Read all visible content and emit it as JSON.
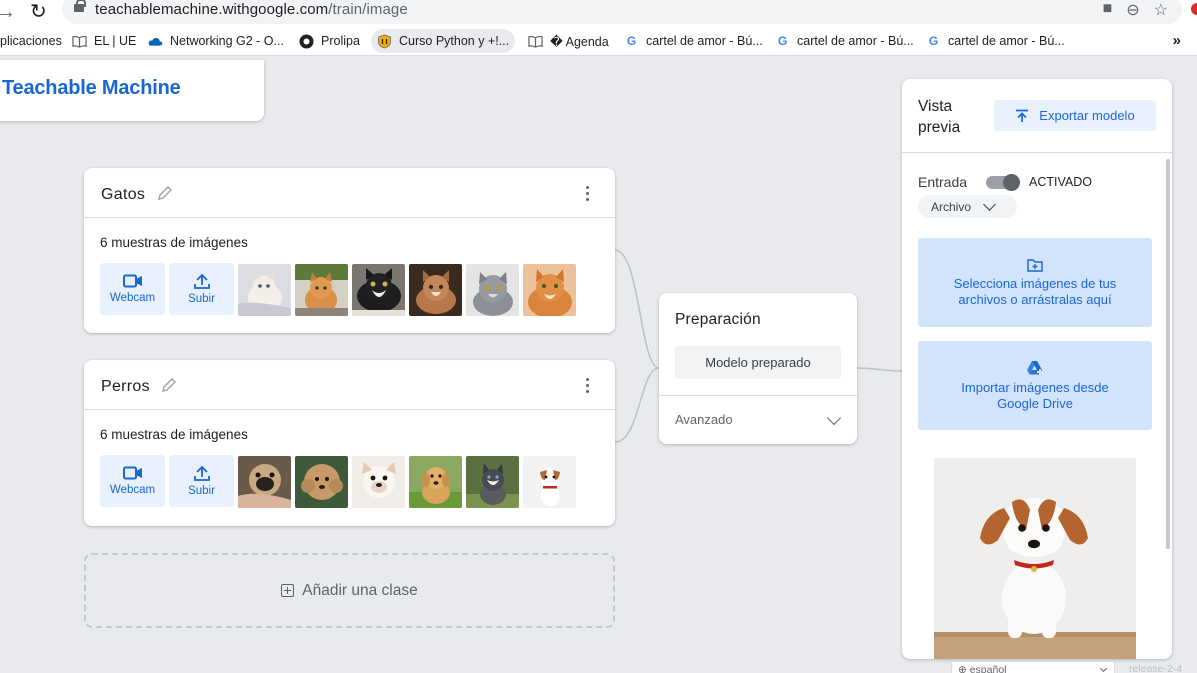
{
  "browser": {
    "url_host": "teachablemachine.withgoogle.com",
    "url_path": "/train/image",
    "bookmarks": [
      {
        "label": "plicaciones",
        "icon": "apps-icon"
      },
      {
        "label": "EL | UE",
        "icon": "book-icon"
      },
      {
        "label": "Networking G2 - O...",
        "icon": "cloud-icon"
      },
      {
        "label": "Prolipa",
        "icon": "prolipa-icon"
      },
      {
        "label": "Curso Python y +!...",
        "icon": "shield-icon"
      },
      {
        "label": "� Agenda",
        "icon": "book-icon"
      },
      {
        "label": "cartel de amor - Bú...",
        "icon": "google-icon"
      },
      {
        "label": "cartel de amor - Bú...",
        "icon": "google-icon"
      },
      {
        "label": "cartel de amor - Bú...",
        "icon": "google-icon"
      }
    ],
    "more": "»"
  },
  "app": {
    "logo": "Teachable Machine"
  },
  "classes": [
    {
      "name": "Gatos",
      "samples": "6 muestras de imágenes",
      "webcam_label": "Webcam",
      "upload_label": "Subir",
      "thumbnails": [
        "white-kitten",
        "orange-kitten",
        "tuxedo-cat",
        "calico-cat",
        "gray-cat",
        "orange-cat"
      ]
    },
    {
      "name": "Perros",
      "samples": "6 muestras de imágenes",
      "webcam_label": "Webcam",
      "upload_label": "Subir",
      "thumbnails": [
        "pug",
        "poodle",
        "bulldog",
        "golden-retriever",
        "husky",
        "jack-russell"
      ]
    }
  ],
  "add_class": "Añadir una clase",
  "training": {
    "title": "Preparación",
    "button": "Modelo preparado",
    "advanced": "Avanzado"
  },
  "preview": {
    "title": "Vista previa",
    "export": "Exportar modelo",
    "input_label": "Entrada",
    "toggle_state": "ACTIVADO",
    "source": "Archivo",
    "file_drop": "Selecciona imágenes de tus archivos o arrástralas aquí",
    "drive_import": "Importar imágenes desde Google Drive",
    "image": "jack-russell-puppy"
  },
  "footer": {
    "language": "español",
    "release": "release-2-4"
  },
  "colors": {
    "accent": "#1967d2",
    "accent_bg": "#e8f0fe",
    "drop_bg": "#d2e3fc"
  }
}
